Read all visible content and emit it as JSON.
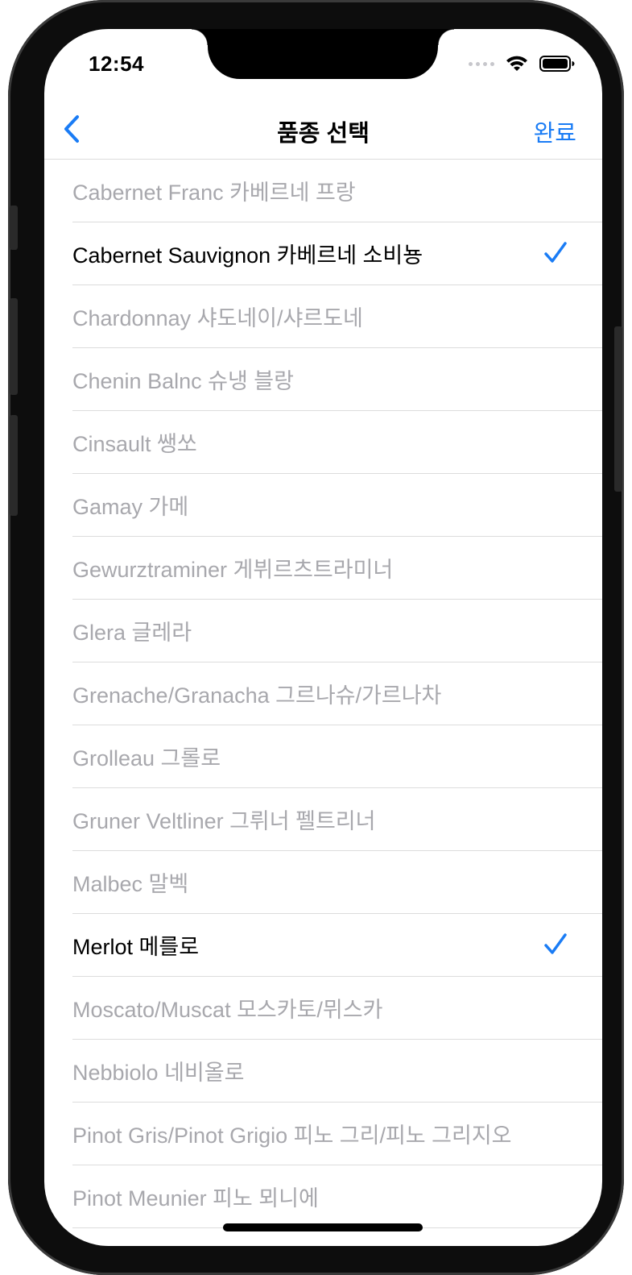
{
  "status_bar": {
    "time": "12:54"
  },
  "nav": {
    "title": "품종 선택",
    "done_label": "완료"
  },
  "colors": {
    "accent": "#1a7cf5",
    "unselected_text": "#a8a8ad",
    "selected_text": "#000000"
  },
  "varieties": [
    {
      "label": "Cabernet Franc 카베르네 프랑",
      "selected": false
    },
    {
      "label": "Cabernet Sauvignon 카베르네 소비뇽",
      "selected": true
    },
    {
      "label": "Chardonnay 샤도네이/샤르도네",
      "selected": false
    },
    {
      "label": "Chenin Balnc 슈냉 블랑",
      "selected": false
    },
    {
      "label": "Cinsault 쌩쏘",
      "selected": false
    },
    {
      "label": "Gamay 가메",
      "selected": false
    },
    {
      "label": "Gewurztraminer 게뷔르츠트라미너",
      "selected": false
    },
    {
      "label": "Glera 글레라",
      "selected": false
    },
    {
      "label": "Grenache/Granacha 그르나슈/가르나차",
      "selected": false
    },
    {
      "label": "Grolleau 그롤로",
      "selected": false
    },
    {
      "label": "Gruner Veltliner 그뤼너 펠트리너",
      "selected": false
    },
    {
      "label": "Malbec 말벡",
      "selected": false
    },
    {
      "label": "Merlot 메를로",
      "selected": true
    },
    {
      "label": "Moscato/Muscat 모스카토/뮈스카",
      "selected": false
    },
    {
      "label": "Nebbiolo 네비올로",
      "selected": false
    },
    {
      "label": "Pinot Gris/Pinot Grigio 피노 그리/피노 그리지오",
      "selected": false
    },
    {
      "label": "Pinot Meunier 피노 뫼니에",
      "selected": false
    }
  ]
}
